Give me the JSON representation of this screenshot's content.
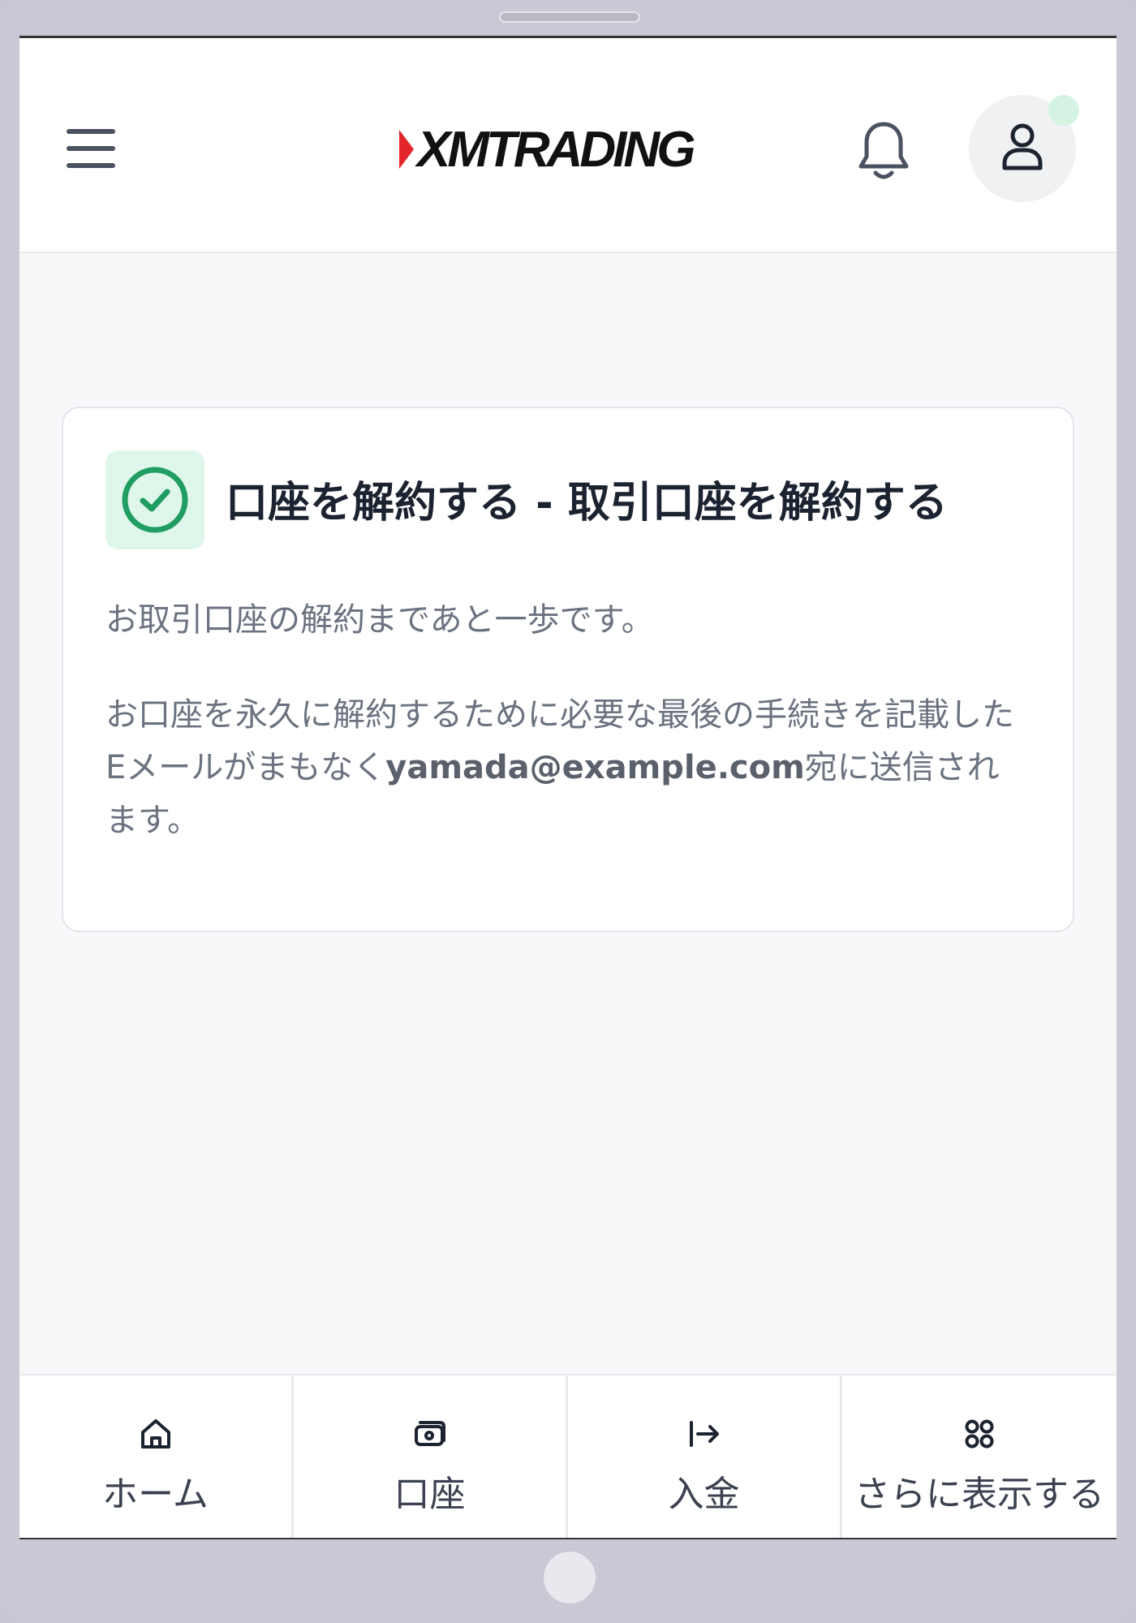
{
  "header": {
    "menu_icon": "hamburger-menu-icon",
    "logo_text": "XMTRADING",
    "bell_icon": "bell-icon",
    "avatar_icon": "user-icon",
    "brand_red": "#e3262b"
  },
  "card": {
    "status_icon": "check-circle-icon",
    "title": "口座を解約する - 取引口座を解約する",
    "line1": "お取引口座の解約まであと一歩です。",
    "para_before": "お口座を永久に解約するために必要な最後の手続きを記載したEメールがまもなく",
    "email": "yamada@example.com",
    "para_after": "宛に送信されます。",
    "accent_green": "#1f9d62"
  },
  "bottom_nav": {
    "items": [
      {
        "label": "ホーム",
        "icon": "home-icon"
      },
      {
        "label": "口座",
        "icon": "wallet-icon"
      },
      {
        "label": "入金",
        "icon": "deposit-arrow-icon"
      },
      {
        "label": "さらに表示する",
        "icon": "grid-icon"
      }
    ]
  }
}
